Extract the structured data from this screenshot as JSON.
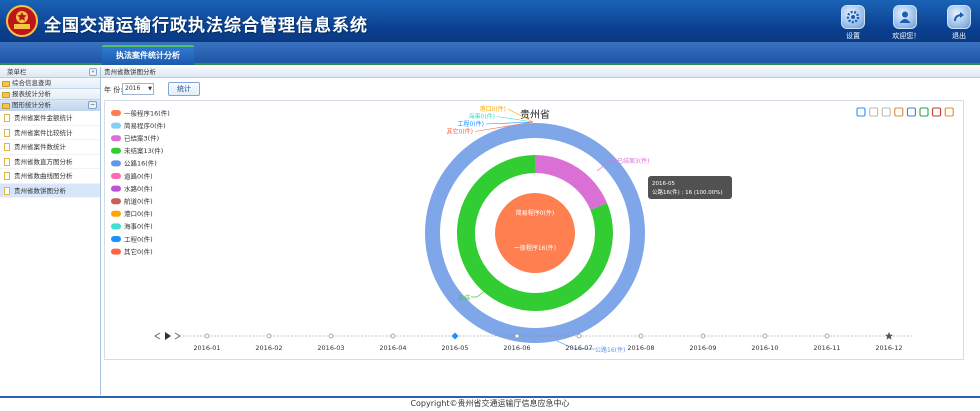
{
  "app": {
    "title": "全国交通运输行政执法综合管理信息系统"
  },
  "header": {
    "buttons": [
      {
        "label": "设置"
      },
      {
        "label": " 欢迎您！"
      },
      {
        "label": "退出"
      }
    ]
  },
  "tabs": [
    {
      "label": "执法案件统计分析"
    }
  ],
  "sidebar": {
    "title": "菜单栏",
    "collapse": "«",
    "groups": [
      {
        "label": "综合信息查询"
      },
      {
        "label": "报表统计分析"
      },
      {
        "label": "图形统计分析",
        "toggle": "−"
      }
    ],
    "items": [
      {
        "label": "贵州省案件金额统计"
      },
      {
        "label": "贵州省案件比较统计"
      },
      {
        "label": "贵州省案件数统计"
      },
      {
        "label": "贵州省数直方图分析"
      },
      {
        "label": "贵州省数曲线图分析"
      },
      {
        "label": "贵州省数饼图分析"
      }
    ]
  },
  "breadcrumb": "贵州省数饼图分析",
  "filter": {
    "year_label": "年 份:",
    "year_value": "2016",
    "year_arrow": "▼",
    "query_label": "统计"
  },
  "chart_data": {
    "type": "pie",
    "title": "贵州省",
    "legend": [
      {
        "name": "一般程序16(件)",
        "color": "#ff7f50"
      },
      {
        "name": "简易程序0(件)",
        "color": "#87cefa"
      },
      {
        "name": "已结案3(件)",
        "color": "#da70d6"
      },
      {
        "name": "未结案13(件)",
        "color": "#32cd32"
      },
      {
        "name": "公路16(件)",
        "color": "#6495ed"
      },
      {
        "name": "道路0(件)",
        "color": "#ff69b4"
      },
      {
        "name": "水路0(件)",
        "color": "#ba55d3"
      },
      {
        "name": "航道0(件)",
        "color": "#cd5c5c"
      },
      {
        "name": "港口0(件)",
        "color": "#ffa500"
      },
      {
        "name": "海事0(件)",
        "color": "#40e0d0"
      },
      {
        "name": "工程0(件)",
        "color": "#1e90ff"
      },
      {
        "name": "其它0(件)",
        "color": "#ff6347"
      }
    ],
    "inner_ring": [
      {
        "name": "一般程序16(件)",
        "value": 16,
        "color": "#ff7f50"
      },
      {
        "name": "简易程序0(件)",
        "value": 0,
        "color": "#87cefa"
      }
    ],
    "middle_ring": [
      {
        "name": "已结案3(件)",
        "value": 3,
        "color": "#da70d6"
      },
      {
        "name": "未结案13(件)",
        "value": 13,
        "color": "#32cd32"
      }
    ],
    "outer_ring": [
      {
        "name": "公路16(件)",
        "value": 16,
        "color": "#7ea6e8"
      },
      {
        "name": "道路0(件)",
        "value": 0,
        "color": "#ff69b4"
      },
      {
        "name": "水路0(件)",
        "value": 0,
        "color": "#ba55d3"
      },
      {
        "name": "航道0(件)",
        "value": 0,
        "color": "#cd5c5c"
      },
      {
        "name": "港口0(件)",
        "value": 0,
        "color": "#ffa500"
      },
      {
        "name": "海事0(件)",
        "value": 0,
        "color": "#40e0d0"
      },
      {
        "name": "工程0(件)",
        "value": 0,
        "color": "#1e90ff"
      },
      {
        "name": "其它0(件)",
        "value": 0,
        "color": "#ff6347"
      }
    ],
    "slice_labels": {
      "inner_top": "简易程序0(件)",
      "inner_center": "一般程序16(件)",
      "middle_right": "已结案3(件)",
      "middle_left": "未结",
      "outer_bottom": "公路16(件)",
      "outer_top": [
        {
          "text": "港口0(件)",
          "color": "#ffa500"
        },
        {
          "text": "海事0(件)",
          "color": "#40e0d0"
        },
        {
          "text": "工程0(件)",
          "color": "#1e90ff"
        },
        {
          "text": "其它0(件)",
          "color": "#ff6347"
        }
      ]
    },
    "tooltip": {
      "line1": "2016-05",
      "line2": "公路16(件) : 16 (100.00%)"
    },
    "timeline": {
      "labels": [
        "2016-01",
        "2016-02",
        "2016-03",
        "2016-04",
        "2016-05",
        "2016-06",
        "2016-07",
        "2016-08",
        "2016-09",
        "2016-10",
        "2016-11",
        "2016-12"
      ],
      "current": "2016-05"
    },
    "toolbox": [
      {
        "name": "mark-icon",
        "color": "#1e90ff"
      },
      {
        "name": "mark-undo-icon",
        "color": "#bbb"
      },
      {
        "name": "mark-clear-icon",
        "color": "#bbb"
      },
      {
        "name": "data-view-icon",
        "color": "#e08a2b"
      },
      {
        "name": "pie-type-icon",
        "color": "#4a7fd0"
      },
      {
        "name": "funnel-type-icon",
        "color": "#2aa24a"
      },
      {
        "name": "restore-icon",
        "color": "#c0392b"
      },
      {
        "name": "save-image-icon",
        "color": "#e08a2b"
      }
    ]
  },
  "footer": "Copyright©贵州省交通运输厅信息应急中心"
}
